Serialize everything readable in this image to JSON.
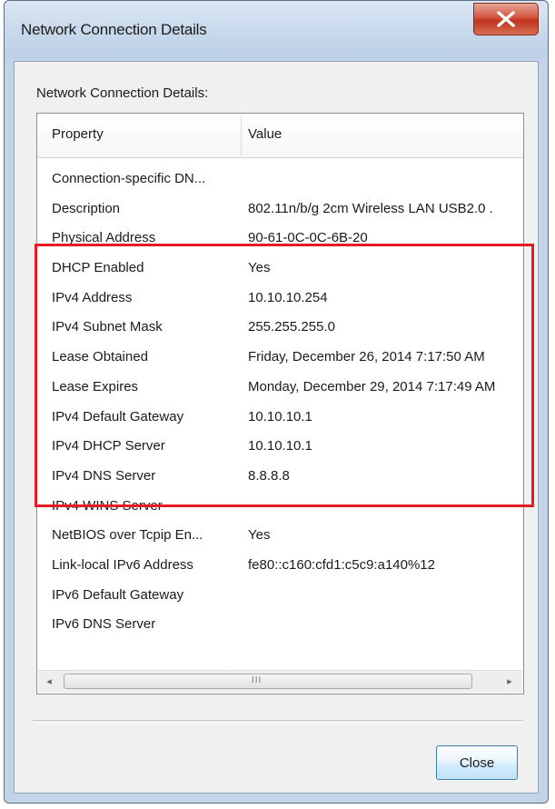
{
  "window": {
    "title": "Network Connection Details",
    "close_glyph": "close-icon"
  },
  "group_label": "Network Connection Details:",
  "list": {
    "columns": [
      "Property",
      "Value"
    ],
    "rows": [
      {
        "property": "Connection-specific DN...",
        "value": ""
      },
      {
        "property": "Description",
        "value": "802.11n/b/g 2cm Wireless LAN USB2.0 ."
      },
      {
        "property": "Physical Address",
        "value": "90-61-0C-0C-6B-20"
      },
      {
        "property": "DHCP Enabled",
        "value": "Yes"
      },
      {
        "property": "IPv4 Address",
        "value": "10.10.10.254"
      },
      {
        "property": "IPv4 Subnet Mask",
        "value": "255.255.255.0"
      },
      {
        "property": "Lease Obtained",
        "value": "Friday, December 26, 2014 7:17:50 AM"
      },
      {
        "property": "Lease Expires",
        "value": "Monday, December 29, 2014 7:17:49 AM"
      },
      {
        "property": "IPv4 Default Gateway",
        "value": "10.10.10.1"
      },
      {
        "property": "IPv4 DHCP Server",
        "value": "10.10.10.1"
      },
      {
        "property": "IPv4 DNS Server",
        "value": "8.8.8.8"
      },
      {
        "property": "IPv4 WINS Server",
        "value": ""
      },
      {
        "property": "NetBIOS over Tcpip En...",
        "value": "Yes"
      },
      {
        "property": "Link-local IPv6 Address",
        "value": "fe80::c160:cfd1:c5c9:a140%12"
      },
      {
        "property": "IPv6 Default Gateway",
        "value": ""
      },
      {
        "property": "IPv6 DNS Server",
        "value": ""
      }
    ]
  },
  "scrollbar": {
    "left_arrow": "◂",
    "right_arrow": "▸",
    "grip": "III"
  },
  "buttons": {
    "close_label": "Close"
  },
  "colors": {
    "highlight": "#e31b23",
    "title_close": "#c0331c"
  }
}
